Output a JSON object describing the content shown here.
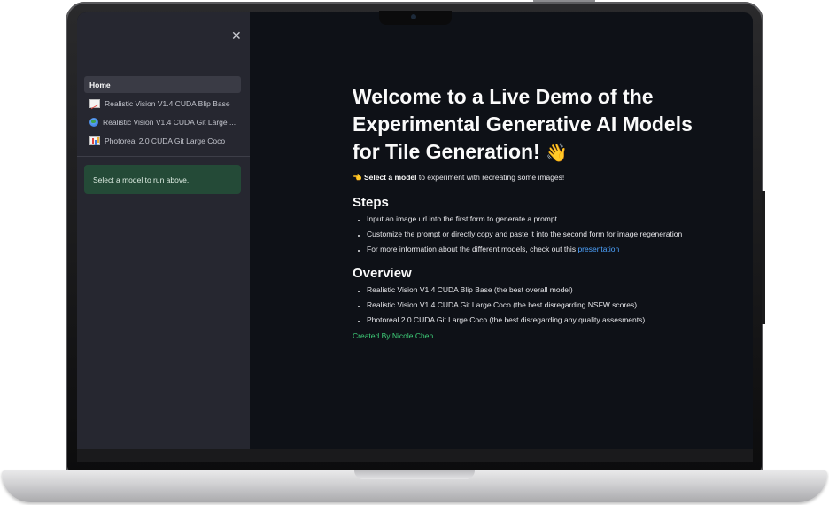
{
  "sidebar": {
    "close_icon": "✕",
    "items": [
      {
        "label": "Home",
        "icon": "none"
      },
      {
        "label": "Realistic Vision V1.4 CUDA Blip Base",
        "icon": "chart-increasing-icon"
      },
      {
        "label": "Realistic Vision V1.4 CUDA Git Large ...",
        "icon": "globe-icon"
      },
      {
        "label": "Photoreal 2.0 CUDA Git Large Coco",
        "icon": "bar-chart-icon"
      }
    ],
    "info": "Select a model to run above."
  },
  "main": {
    "title": "Welcome to a Live Demo of the Experimental Generative AI Models for Tile Generation!",
    "wave": "👋",
    "intro_pointer": "👈",
    "intro_bold": "Select a model",
    "intro_rest": " to experiment with recreating some images!",
    "steps_heading": "Steps",
    "steps": [
      "Input an image url into the first form to generate a prompt",
      "Customize the prompt or directly copy and paste it into the second form for image regeneration",
      "For more information about the different models, check out this "
    ],
    "steps_link": "presentation",
    "overview_heading": "Overview",
    "overview": [
      "Realistic Vision V1.4 CUDA Blip Base (the best overall model)",
      "Realistic Vision V1.4 CUDA Git Large Coco (the best disregarding NSFW scores)",
      "Photoreal 2.0 CUDA Git Large Coco (the best disregarding any quality assesments)"
    ],
    "credit": "Created By Nicole Chen"
  },
  "colors": {
    "background": "#0e1117",
    "sidebar": "#262730",
    "info_box": "#244a37",
    "link": "#4da3ff",
    "credit": "#3fd07a"
  }
}
